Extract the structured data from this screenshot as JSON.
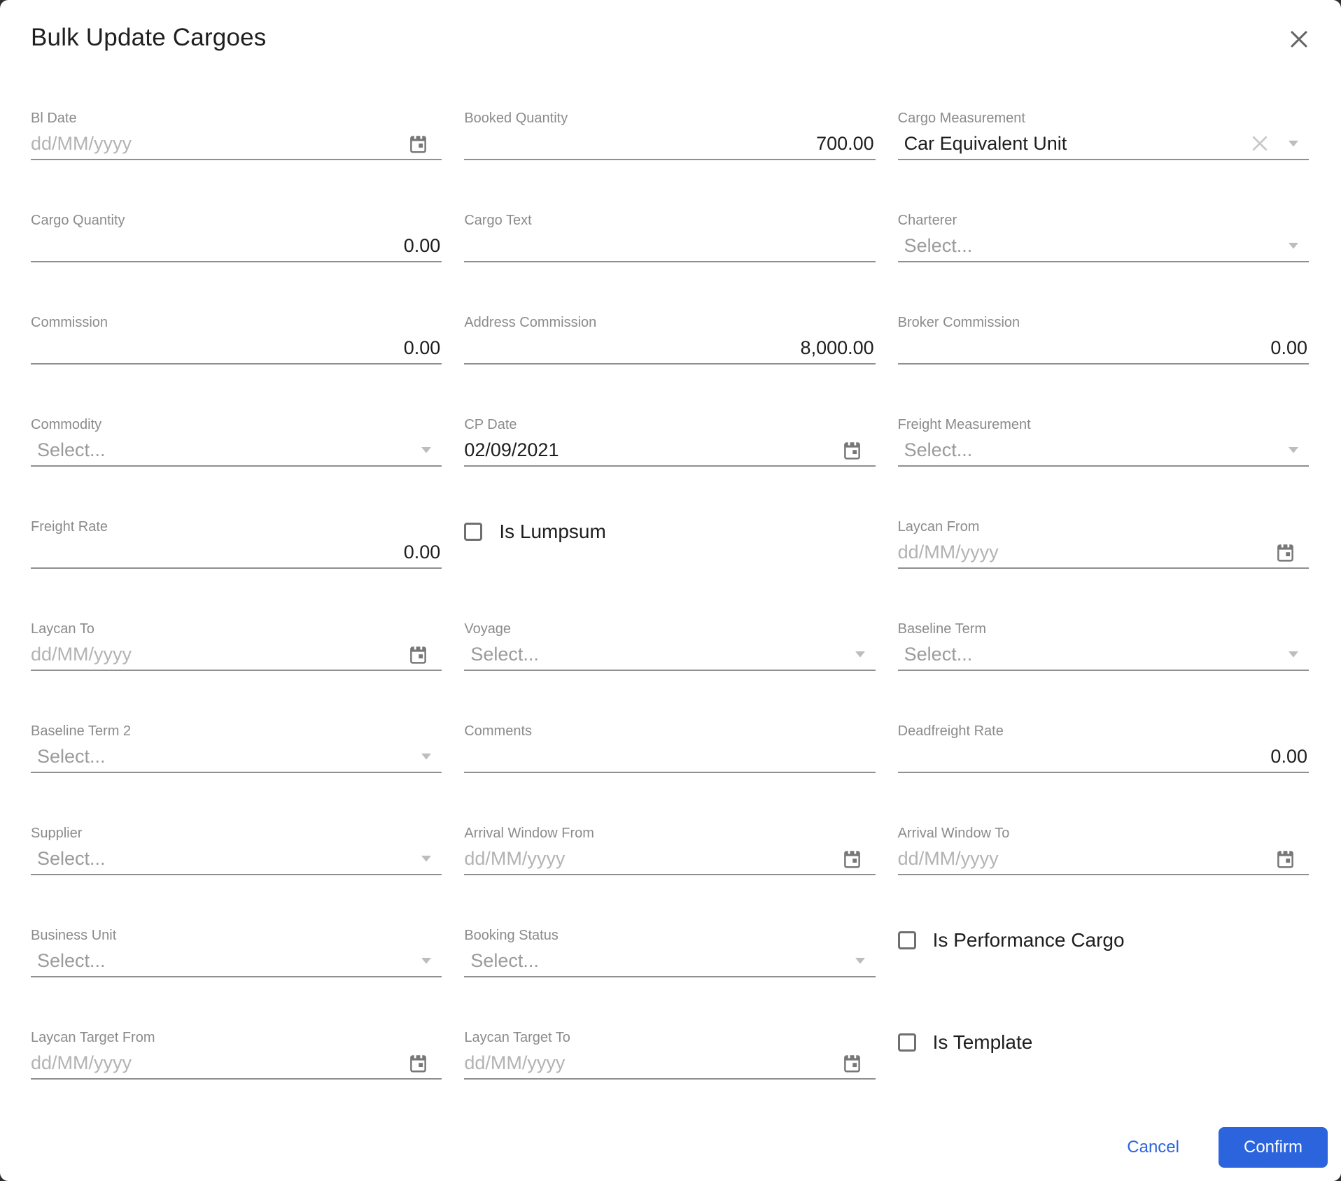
{
  "modal": {
    "title": "Bulk Update Cargoes"
  },
  "colors": {
    "accent": "#2b64dc",
    "underline": "#8f8f8f",
    "label": "#8b8b8b",
    "value": "#1e1e1e",
    "placeholder": "#b3b3b3",
    "select_placeholder": "#9b9b9b"
  },
  "footer": {
    "cancel_label": "Cancel",
    "confirm_label": "Confirm"
  },
  "form": {
    "bl_date": {
      "label": "Bl Date",
      "placeholder": "dd/MM/yyyy"
    },
    "booked_quantity": {
      "label": "Booked Quantity",
      "value": "700.00"
    },
    "cargo_measurement": {
      "label": "Cargo Measurement",
      "value": "Car Equivalent Unit"
    },
    "cargo_quantity": {
      "label": "Cargo Quantity",
      "value": "0.00"
    },
    "cargo_text": {
      "label": "Cargo Text",
      "value": ""
    },
    "charterer": {
      "label": "Charterer",
      "placeholder": "Select..."
    },
    "commission": {
      "label": "Commission",
      "value": "0.00"
    },
    "address_commission": {
      "label": "Address Commission",
      "value": "8,000.00"
    },
    "broker_commission": {
      "label": "Broker Commission",
      "value": "0.00"
    },
    "commodity": {
      "label": "Commodity",
      "placeholder": "Select..."
    },
    "cp_date": {
      "label": "CP Date",
      "value": "02/09/2021"
    },
    "freight_measurement": {
      "label": "Freight Measurement",
      "placeholder": "Select..."
    },
    "freight_rate": {
      "label": "Freight Rate",
      "value": "0.00"
    },
    "is_lumpsum": {
      "label": "Is Lumpsum",
      "checked": false
    },
    "laycan_from": {
      "label": "Laycan From",
      "placeholder": "dd/MM/yyyy"
    },
    "laycan_to": {
      "label": "Laycan To",
      "placeholder": "dd/MM/yyyy"
    },
    "voyage": {
      "label": "Voyage",
      "placeholder": "Select..."
    },
    "baseline_term": {
      "label": "Baseline Term",
      "placeholder": "Select..."
    },
    "baseline_term_2": {
      "label": "Baseline Term 2",
      "placeholder": "Select..."
    },
    "comments": {
      "label": "Comments",
      "value": ""
    },
    "deadfreight_rate": {
      "label": "Deadfreight Rate",
      "value": "0.00"
    },
    "supplier": {
      "label": "Supplier",
      "placeholder": "Select..."
    },
    "arrival_window_from": {
      "label": "Arrival Window From",
      "placeholder": "dd/MM/yyyy"
    },
    "arrival_window_to": {
      "label": "Arrival Window To",
      "placeholder": "dd/MM/yyyy"
    },
    "business_unit": {
      "label": "Business Unit",
      "placeholder": "Select..."
    },
    "booking_status": {
      "label": "Booking Status",
      "placeholder": "Select..."
    },
    "is_performance_cargo": {
      "label": "Is Performance Cargo",
      "checked": false
    },
    "laycan_target_from": {
      "label": "Laycan Target From",
      "placeholder": "dd/MM/yyyy"
    },
    "laycan_target_to": {
      "label": "Laycan Target To",
      "placeholder": "dd/MM/yyyy"
    },
    "is_template": {
      "label": "Is Template",
      "checked": false
    }
  }
}
